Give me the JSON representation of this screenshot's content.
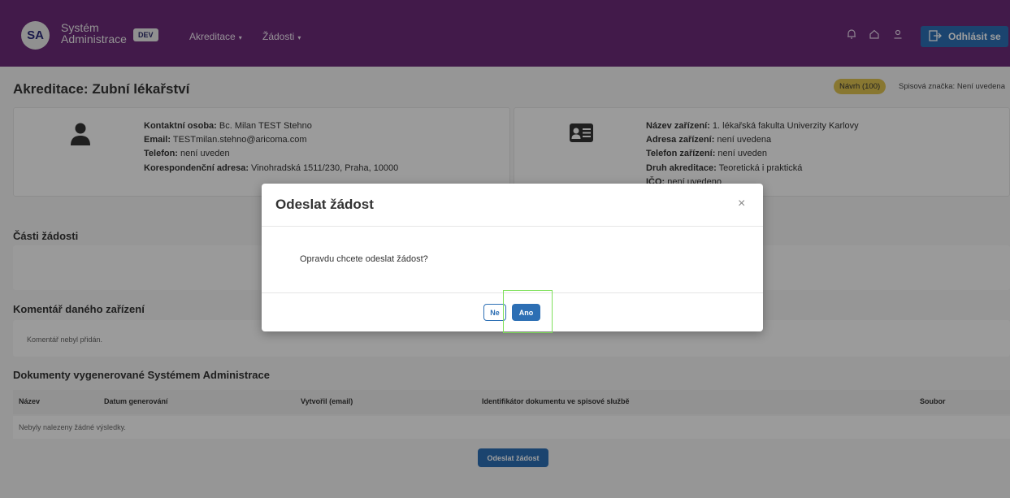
{
  "navbar": {
    "logo_text": "SA",
    "brand_line1": "Systém",
    "brand_line2": "Administrace",
    "env_badge": "DEV",
    "menu_accreditation": "Akreditace",
    "menu_requests": "Žádosti",
    "caret": "▾",
    "bell_icon": "bell-icon",
    "home_icon": "home-icon",
    "user_icon": "user-icon",
    "logout_label": "Odhlásit se"
  },
  "page": {
    "title": "Akreditace: Zubní lékařství",
    "status_badge": "Návrh (100)",
    "file_mark": "Spisová značka: Není uvedena"
  },
  "contact": {
    "person_label": "Kontaktní osoba:",
    "person_value": " Bc. Milan TEST Stehno",
    "email_label": "Email:",
    "email_value": " TESTmilan.stehno@aricoma.com",
    "phone_label": "Telefon:",
    "phone_value": " není uveden",
    "address_label": "Korespondenční adresa:",
    "address_value": " Vinohradská 1511/230, Praha, 10000"
  },
  "facility": {
    "name_label": "Název zařízení:",
    "name_value": " 1. lékařská fakulta Univerzity Karlovy",
    "address_label": "Adresa zařízení:",
    "address_value": " není uvedena",
    "phone_label": "Telefon zařízení:",
    "phone_value": " není uveden",
    "type_label": "Druh akreditace:",
    "type_value": " Teoretická i praktická",
    "ico_label": "IČO:",
    "ico_value": " není uvedeno"
  },
  "sections": {
    "parts": "Části žádosti",
    "comment": "Komentář daného zařízení",
    "comment_empty": "Komentář nebyl přidán.",
    "documents": "Dokumenty vygenerované Systémem Administrace"
  },
  "table": {
    "columns": [
      "Název",
      "Datum generování",
      "Vytvořil (email)",
      "Identifikátor dokumentu ve spisové službě",
      "Soubor"
    ],
    "empty": "Nebyly nalezeny žádné výsledky."
  },
  "submit_button": "Odeslat žádost",
  "modal": {
    "title": "Odeslat žádost",
    "close": "×",
    "body": "Opravdu chcete odeslat žádost?",
    "no_label": "Ne",
    "yes_label": "Ano"
  },
  "colors": {
    "navbar": "#6b2a78",
    "primary": "#2d6fb4",
    "badge": "#dcc04f",
    "highlight": "#7ee05a"
  }
}
